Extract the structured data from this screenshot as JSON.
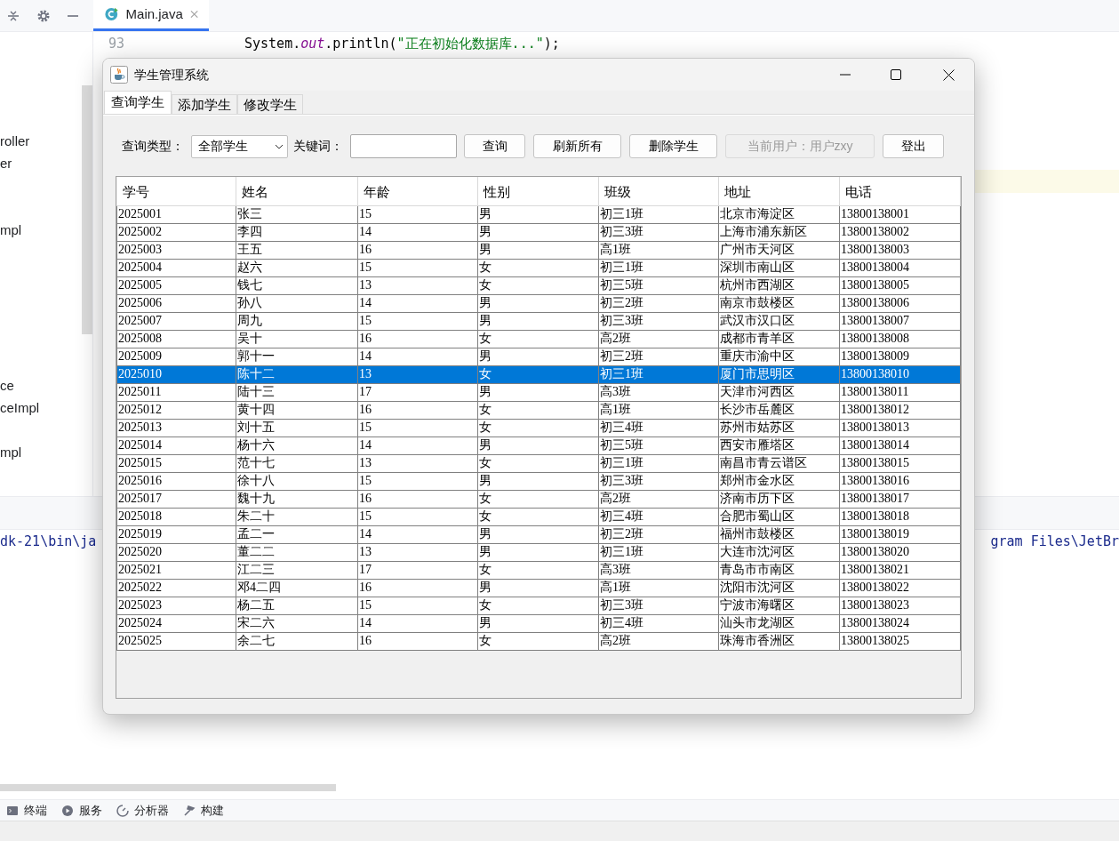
{
  "ide": {
    "editor_tab": "Main.java",
    "line_number": "93",
    "code_line": {
      "before": "System.",
      "italic": "out",
      "after": ".println(",
      "string": "\"正在初始化数据库...\"",
      "end": ");"
    },
    "project_items": [
      "roller",
      "er",
      "mpl",
      "ce",
      "ceImpl",
      "mpl"
    ],
    "console": {
      "left": "dk-21\\bin\\ja",
      "right": "gram Files\\JetBr"
    },
    "tool_windows": [
      {
        "label": "终端",
        "kind": "terminal"
      },
      {
        "label": "服务",
        "kind": "services"
      },
      {
        "label": "分析器",
        "kind": "profiler"
      },
      {
        "label": "构建",
        "kind": "build"
      }
    ]
  },
  "dialog": {
    "title": "学生管理系统",
    "tabs": [
      {
        "label": "查询学生",
        "selected": true
      },
      {
        "label": "添加学生",
        "selected": false
      },
      {
        "label": "修改学生",
        "selected": false
      }
    ],
    "query_type": {
      "label": "查询类型：",
      "value": "全部学生"
    },
    "keyword": {
      "label": "关键词："
    },
    "buttons": [
      "查询",
      "刷新所有",
      "删除学生"
    ],
    "current_user": {
      "value": "当前用户：用户zxy",
      "disabled": true
    },
    "logout": "登出",
    "table": {
      "columns": [
        "学号",
        "姓名",
        "年龄",
        "性别",
        "班级",
        "地址",
        "电话"
      ],
      "rows": [
        {
          "cells": [
            "2025001",
            "张三",
            "15",
            "男",
            "初三1班",
            "北京市海淀区",
            "13800138001"
          ],
          "selected": false
        },
        {
          "cells": [
            "2025002",
            "李四",
            "14",
            "男",
            "初三3班",
            "上海市浦东新区",
            "13800138002"
          ],
          "selected": false
        },
        {
          "cells": [
            "2025003",
            "王五",
            "16",
            "男",
            "高1班",
            "广州市天河区",
            "13800138003"
          ],
          "selected": false
        },
        {
          "cells": [
            "2025004",
            "赵六",
            "15",
            "女",
            "初三1班",
            "深圳市南山区",
            "13800138004"
          ],
          "selected": false
        },
        {
          "cells": [
            "2025005",
            "钱七",
            "13",
            "女",
            "初三5班",
            "杭州市西湖区",
            "13800138005"
          ],
          "selected": false
        },
        {
          "cells": [
            "2025006",
            "孙八",
            "14",
            "男",
            "初三2班",
            "南京市鼓楼区",
            "13800138006"
          ],
          "selected": false
        },
        {
          "cells": [
            "2025007",
            "周九",
            "15",
            "男",
            "初三3班",
            "武汉市汉口区",
            "13800138007"
          ],
          "selected": false
        },
        {
          "cells": [
            "2025008",
            "吴十",
            "16",
            "女",
            "高2班",
            "成都市青羊区",
            "13800138008"
          ],
          "selected": false
        },
        {
          "cells": [
            "2025009",
            "郭十一",
            "14",
            "男",
            "初三2班",
            "重庆市渝中区",
            "13800138009"
          ],
          "selected": false
        },
        {
          "cells": [
            "2025010",
            "陈十二",
            "13",
            "女",
            "初三1班",
            "厦门市思明区",
            "13800138010"
          ],
          "selected": true
        },
        {
          "cells": [
            "2025011",
            "陆十三",
            "17",
            "男",
            "高3班",
            "天津市河西区",
            "13800138011"
          ],
          "selected": false
        },
        {
          "cells": [
            "2025012",
            "黄十四",
            "16",
            "女",
            "高1班",
            "长沙市岳麓区",
            "13800138012"
          ],
          "selected": false
        },
        {
          "cells": [
            "2025013",
            "刘十五",
            "15",
            "女",
            "初三4班",
            "苏州市姑苏区",
            "13800138013"
          ],
          "selected": false
        },
        {
          "cells": [
            "2025014",
            "杨十六",
            "14",
            "男",
            "初三5班",
            "西安市雁塔区",
            "13800138014"
          ],
          "selected": false
        },
        {
          "cells": [
            "2025015",
            "范十七",
            "13",
            "女",
            "初三1班",
            "南昌市青云谱区",
            "13800138015"
          ],
          "selected": false
        },
        {
          "cells": [
            "2025016",
            "徐十八",
            "15",
            "男",
            "初三3班",
            "郑州市金水区",
            "13800138016"
          ],
          "selected": false
        },
        {
          "cells": [
            "2025017",
            "魏十九",
            "16",
            "女",
            "高2班",
            "济南市历下区",
            "13800138017"
          ],
          "selected": false
        },
        {
          "cells": [
            "2025018",
            "朱二十",
            "15",
            "女",
            "初三4班",
            "合肥市蜀山区",
            "13800138018"
          ],
          "selected": false
        },
        {
          "cells": [
            "2025019",
            "孟二一",
            "14",
            "男",
            "初三2班",
            "福州市鼓楼区",
            "13800138019"
          ],
          "selected": false
        },
        {
          "cells": [
            "2025020",
            "董二二",
            "13",
            "男",
            "初三1班",
            "大连市沈河区",
            "13800138020"
          ],
          "selected": false
        },
        {
          "cells": [
            "2025021",
            "江二三",
            "17",
            "女",
            "高3班",
            "青岛市市南区",
            "13800138021"
          ],
          "selected": false
        },
        {
          "cells": [
            "2025022",
            "邓4二四",
            "16",
            "男",
            "高1班",
            "沈阳市沈河区",
            "13800138022"
          ],
          "selected": false
        },
        {
          "cells": [
            "2025023",
            "杨二五",
            "15",
            "女",
            "初三3班",
            "宁波市海曙区",
            "13800138023"
          ],
          "selected": false
        },
        {
          "cells": [
            "2025024",
            "宋二六",
            "14",
            "男",
            "初三4班",
            "汕头市龙湖区",
            "13800138024"
          ],
          "selected": false
        },
        {
          "cells": [
            "2025025",
            "余二七",
            "16",
            "女",
            "高2班",
            "珠海市香洲区",
            "13800138025"
          ],
          "selected": false
        }
      ]
    }
  }
}
